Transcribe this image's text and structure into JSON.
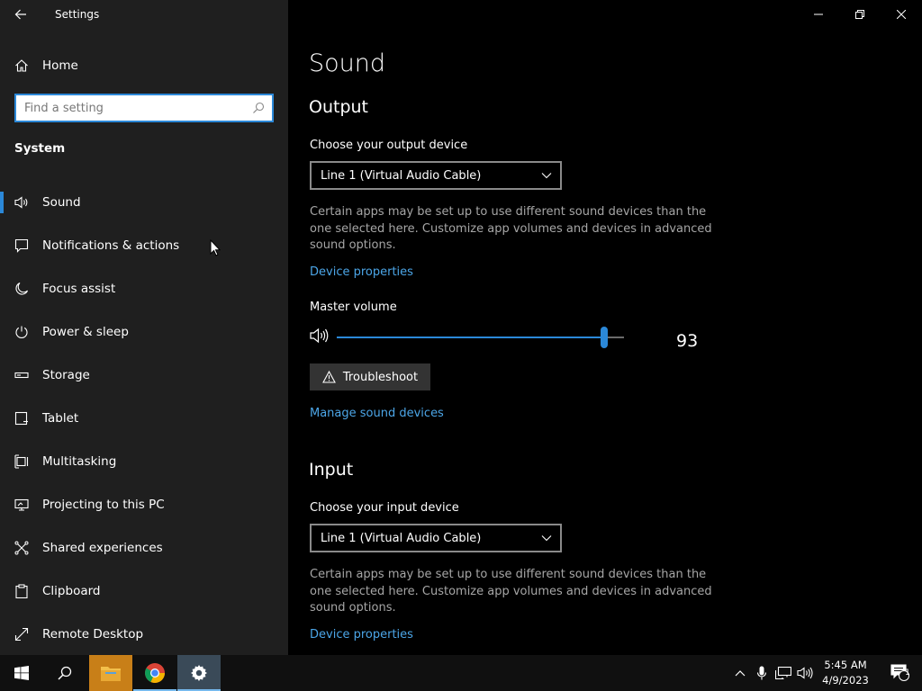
{
  "window": {
    "title": "Settings"
  },
  "sidebar": {
    "home_label": "Home",
    "search_placeholder": "Find a setting",
    "section_title": "System",
    "items": [
      {
        "label": "Sound",
        "icon": "speaker-icon",
        "selected": true
      },
      {
        "label": "Notifications & actions",
        "icon": "notification-icon"
      },
      {
        "label": "Focus assist",
        "icon": "moon-icon"
      },
      {
        "label": "Power & sleep",
        "icon": "power-icon"
      },
      {
        "label": "Storage",
        "icon": "storage-icon"
      },
      {
        "label": "Tablet",
        "icon": "tablet-icon"
      },
      {
        "label": "Multitasking",
        "icon": "multitasking-icon"
      },
      {
        "label": "Projecting to this PC",
        "icon": "projecting-icon"
      },
      {
        "label": "Shared experiences",
        "icon": "shared-icon"
      },
      {
        "label": "Clipboard",
        "icon": "clipboard-icon"
      },
      {
        "label": "Remote Desktop",
        "icon": "remote-desktop-icon"
      }
    ]
  },
  "main": {
    "title": "Sound",
    "output": {
      "heading": "Output",
      "device_label": "Choose your output device",
      "device_value": "Line 1 (Virtual Audio Cable)",
      "description": "Certain apps may be set up to use different sound devices than the one selected here. Customize app volumes and devices in advanced sound options.",
      "device_properties_link": "Device properties",
      "master_volume_label": "Master volume",
      "volume_value": 93,
      "volume_text": "93",
      "troubleshoot_label": "Troubleshoot",
      "manage_link": "Manage sound devices"
    },
    "input": {
      "heading": "Input",
      "device_label": "Choose your input device",
      "device_value": "Line 1 (Virtual Audio Cable)",
      "description": "Certain apps may be set up to use different sound devices than the one selected here. Customize app volumes and devices in advanced sound options.",
      "device_properties_link": "Device properties"
    }
  },
  "taskbar": {
    "time": "5:45 AM",
    "date": "4/9/2023",
    "notification_count": "1"
  },
  "colors": {
    "accent": "#2b88d8",
    "link": "#4ca6e8",
    "sidebar_bg": "#1f1f1f"
  }
}
